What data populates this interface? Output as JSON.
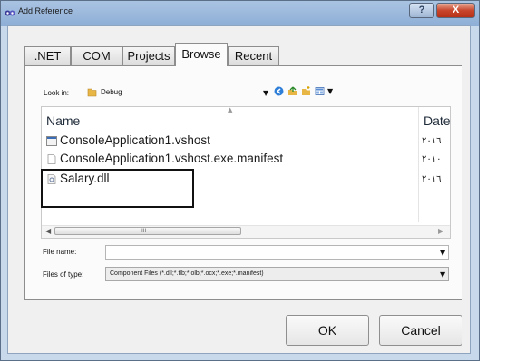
{
  "window": {
    "title": "Add Reference",
    "help_label": "?",
    "close_label": "X"
  },
  "tabs": [
    {
      "label": ".NET"
    },
    {
      "label": "COM"
    },
    {
      "label": "Projects"
    },
    {
      "label": "Browse",
      "active": true
    },
    {
      "label": "Recent"
    }
  ],
  "lookin": {
    "label": "Look in:",
    "value": "Debug"
  },
  "toolbar": {
    "icons": [
      "back-icon",
      "up-folder-icon",
      "new-folder-icon",
      "view-menu-icon"
    ]
  },
  "list": {
    "columns": {
      "name": "Name",
      "date": "Date"
    },
    "rows": [
      {
        "name": "ConsoleApplication1.vshost",
        "date": "٢٠١٦",
        "icon": "exe-icon"
      },
      {
        "name": "ConsoleApplication1.vshost.exe.manifest",
        "date": "٢٠١٠",
        "icon": "file-icon"
      },
      {
        "name": "Salary.dll",
        "date": "٢٠١٦",
        "icon": "dll-icon"
      }
    ]
  },
  "scroll": {
    "grip": "III"
  },
  "filename": {
    "label": "File name:",
    "value": ""
  },
  "filetype": {
    "label": "Files of type:",
    "value": "Component Files (*.dll;*.tlb;*.olb;*.ocx;*.exe;*.manifest)"
  },
  "buttons": {
    "ok": "OK",
    "cancel": "Cancel"
  },
  "colors": {
    "title_bar": "#a9c3e2",
    "close_button": "#c8462c",
    "panel": "#fbfbfb"
  }
}
